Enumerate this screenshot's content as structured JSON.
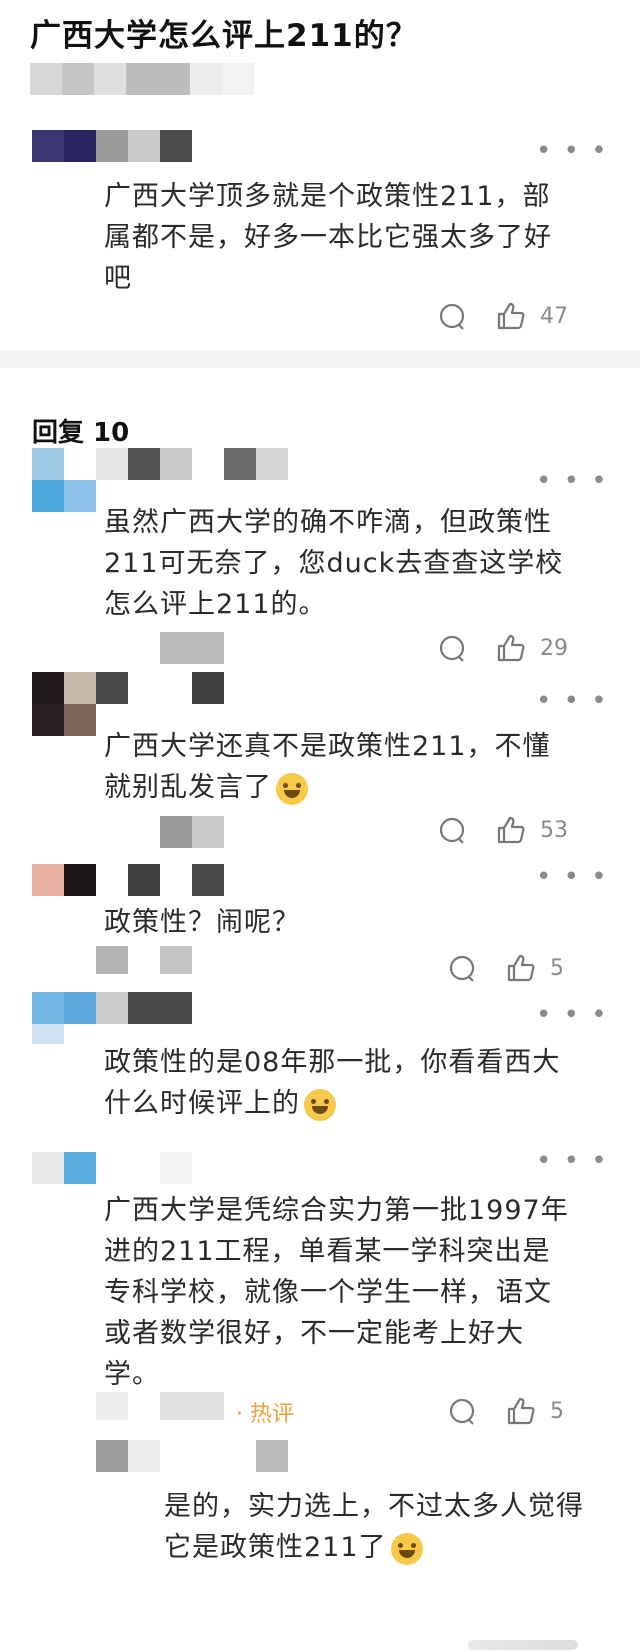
{
  "post": {
    "title": "广西大学怎么评上211的？",
    "comment": {
      "text": "广西大学顶多就是个政策性211，部属都不是，好多一本比它强太多了好吧",
      "likes": "47"
    }
  },
  "replies": {
    "header": "回复 10",
    "items": [
      {
        "text": "虽然广西大学的确不咋滴，但政策性211可无奈了，您duck去查查这学校怎么评上211的。",
        "likes": "29"
      },
      {
        "text": "广西大学还真不是政策性211，不懂就别乱发言了",
        "emoji": "grinning-emoji",
        "likes": "53"
      },
      {
        "text": "政策性？闹呢？",
        "likes": "5"
      },
      {
        "text": "政策性的是08年那一批，你看看西大什么时候评上的",
        "emoji": "grinning-emoji",
        "likes": ""
      },
      {
        "text": "广西大学是凭综合实力第一批1997年进的211工程，单看某一学科突出是专科学校，就像一个学生一样，语文或者数学很好，不一定能考上好大学。",
        "likes": "5",
        "badge": "热评"
      },
      {
        "text": "是的，实力选上，不过太多人觉得它是政策性211了",
        "emoji": "laughing-crying-emoji"
      }
    ]
  },
  "ui": {
    "more": "• • •",
    "icons": [
      "comment-bubble-icon",
      "thumbs-up-icon",
      "more-dots-icon"
    ],
    "colors": {
      "hot": "#e8a23b",
      "muted": "#8a8a8a",
      "divider": "#f3f3f3"
    }
  }
}
